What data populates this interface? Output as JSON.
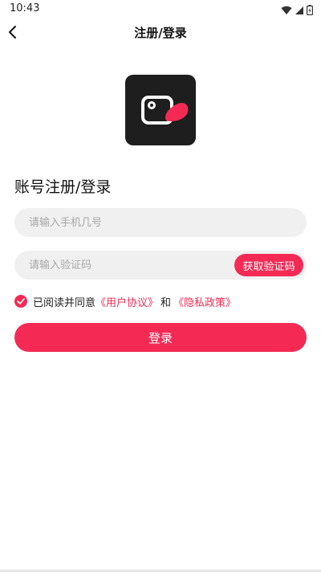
{
  "status_bar": {
    "time": "10:43",
    "icons": [
      "wifi-icon",
      "signal-icon",
      "battery-icon"
    ]
  },
  "nav": {
    "back_icon": "chevron-left-icon",
    "title": "注册/登录"
  },
  "logo": {
    "icon": "video-camera-logo-icon",
    "background_color": "#1e1e1e",
    "accent_color": "#f42a55"
  },
  "form": {
    "section_title": "账号注册/登录",
    "phone_placeholder": "请输入手机几号",
    "phone_value": "",
    "code_placeholder": "请输入验证码",
    "code_value": "",
    "get_code_label": "获取验证码"
  },
  "agreement": {
    "checked": true,
    "prefix": "已阅读并同意",
    "user_agreement": "《用户协议》",
    "and": "和",
    "privacy_policy": "《隐私政策》"
  },
  "login_label": "登录",
  "colors": {
    "accent": "#f42a55",
    "field_bg": "#f0f0f0",
    "placeholder": "#a8a8a8"
  }
}
